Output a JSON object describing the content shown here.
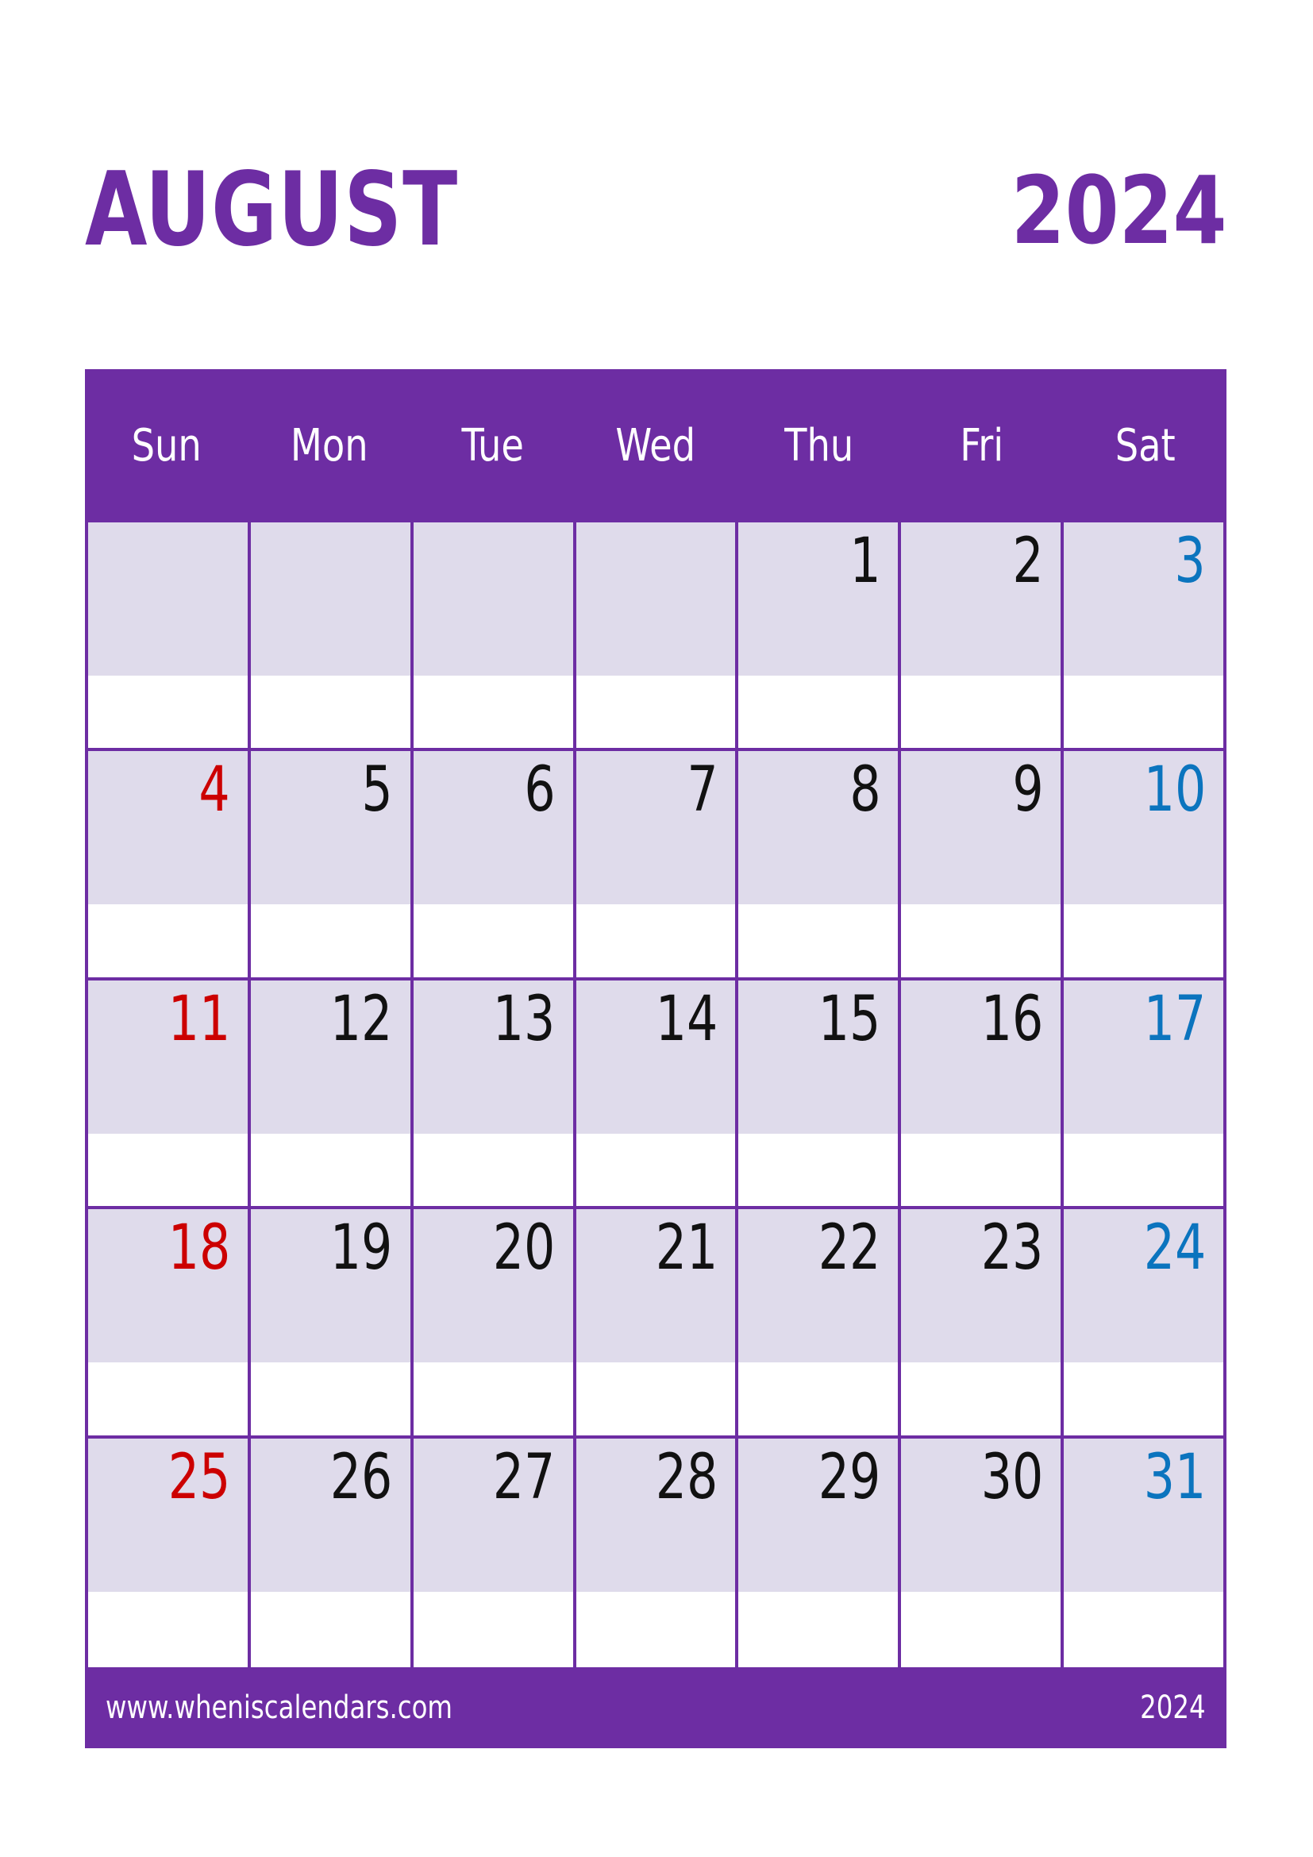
{
  "header": {
    "month": "AUGUST",
    "year": "2024"
  },
  "colors": {
    "brand_purple": "#6D2DA3",
    "cell_lavender": "#DFDBEB",
    "sunday_red": "#CC0000",
    "saturday_blue": "#0B74BE",
    "weekday_black": "#111111",
    "page_white": "#FFFFFF"
  },
  "weekdays": [
    {
      "label": "Sun"
    },
    {
      "label": "Mon"
    },
    {
      "label": "Tue"
    },
    {
      "label": "Wed"
    },
    {
      "label": "Thu"
    },
    {
      "label": "Fri"
    },
    {
      "label": "Sat"
    }
  ],
  "weeks": [
    {
      "days": [
        {
          "num": "",
          "kind": "empty"
        },
        {
          "num": "",
          "kind": "empty"
        },
        {
          "num": "",
          "kind": "empty"
        },
        {
          "num": "",
          "kind": "empty"
        },
        {
          "num": "1",
          "kind": "weekday"
        },
        {
          "num": "2",
          "kind": "weekday"
        },
        {
          "num": "3",
          "kind": "sat"
        }
      ]
    },
    {
      "days": [
        {
          "num": "4",
          "kind": "sun"
        },
        {
          "num": "5",
          "kind": "weekday"
        },
        {
          "num": "6",
          "kind": "weekday"
        },
        {
          "num": "7",
          "kind": "weekday"
        },
        {
          "num": "8",
          "kind": "weekday"
        },
        {
          "num": "9",
          "kind": "weekday"
        },
        {
          "num": "10",
          "kind": "sat"
        }
      ]
    },
    {
      "days": [
        {
          "num": "11",
          "kind": "sun"
        },
        {
          "num": "12",
          "kind": "weekday"
        },
        {
          "num": "13",
          "kind": "weekday"
        },
        {
          "num": "14",
          "kind": "weekday"
        },
        {
          "num": "15",
          "kind": "weekday"
        },
        {
          "num": "16",
          "kind": "weekday"
        },
        {
          "num": "17",
          "kind": "sat"
        }
      ]
    },
    {
      "days": [
        {
          "num": "18",
          "kind": "sun"
        },
        {
          "num": "19",
          "kind": "weekday"
        },
        {
          "num": "20",
          "kind": "weekday"
        },
        {
          "num": "21",
          "kind": "weekday"
        },
        {
          "num": "22",
          "kind": "weekday"
        },
        {
          "num": "23",
          "kind": "weekday"
        },
        {
          "num": "24",
          "kind": "sat"
        }
      ]
    },
    {
      "days": [
        {
          "num": "25",
          "kind": "sun"
        },
        {
          "num": "26",
          "kind": "weekday"
        },
        {
          "num": "27",
          "kind": "weekday"
        },
        {
          "num": "28",
          "kind": "weekday"
        },
        {
          "num": "29",
          "kind": "weekday"
        },
        {
          "num": "30",
          "kind": "weekday"
        },
        {
          "num": "31",
          "kind": "sat"
        }
      ]
    }
  ],
  "footer": {
    "url": "www.wheniscalendars.com",
    "year": "2024"
  }
}
